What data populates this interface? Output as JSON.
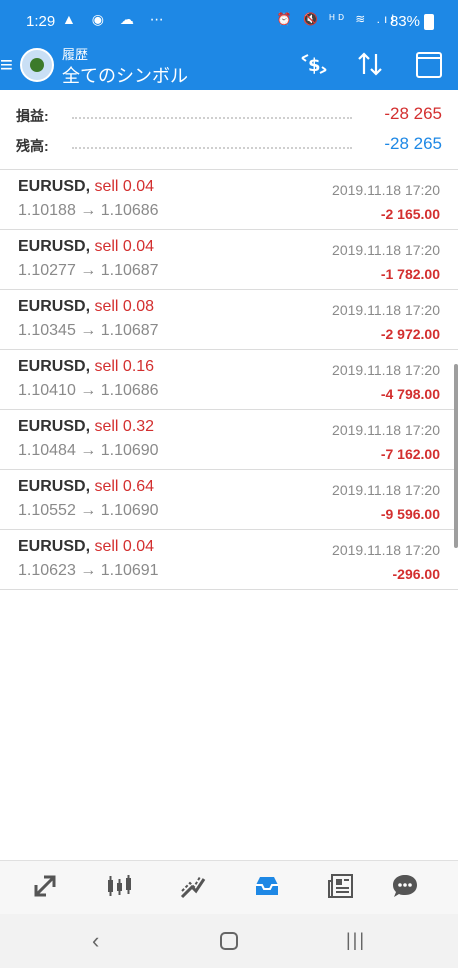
{
  "status_bar": {
    "time": "1:29",
    "left_icons": "▲ ◉ ☁ ⋯",
    "right_icons": "⏰ 🔇 ᴴᴰ ≋ .ıl",
    "battery": "83%"
  },
  "app_bar": {
    "title": "履歴",
    "subtitle": "全てのシンボル",
    "menu_icon": "hamburger-menu-icon",
    "currency_icon": "currency-exchange-icon",
    "sort_icon": "sort-icon",
    "calendar_icon": "calendar-icon"
  },
  "summary": {
    "profit_label": "損益:",
    "profit_value": "-28 265",
    "balance_label": "残高:",
    "balance_value": "-28 265"
  },
  "trades": [
    {
      "symbol": "EURUSD,",
      "side": "sell 0.04",
      "prices": "1.10188 → 1.10686",
      "date": "2019.11.18 17:20",
      "profit": "-2 165.00"
    },
    {
      "symbol": "EURUSD,",
      "side": "sell 0.04",
      "prices": "1.10277 → 1.10687",
      "date": "2019.11.18 17:20",
      "profit": "-1 782.00"
    },
    {
      "symbol": "EURUSD,",
      "side": "sell 0.08",
      "prices": "1.10345 → 1.10687",
      "date": "2019.11.18 17:20",
      "profit": "-2 972.00"
    },
    {
      "symbol": "EURUSD,",
      "side": "sell 0.16",
      "prices": "1.10410 → 1.10686",
      "date": "2019.11.18 17:20",
      "profit": "-4 798.00"
    },
    {
      "symbol": "EURUSD,",
      "side": "sell 0.32",
      "prices": "1.10484 → 1.10690",
      "date": "2019.11.18 17:20",
      "profit": "-7 162.00"
    },
    {
      "symbol": "EURUSD,",
      "side": "sell 0.64",
      "prices": "1.10552 → 1.10690",
      "date": "2019.11.18 17:20",
      "profit": "-9 596.00"
    },
    {
      "symbol": "EURUSD,",
      "side": "sell 0.04",
      "prices": "1.10623 → 1.10691",
      "date": "2019.11.18 17:20",
      "profit": "-296.00"
    }
  ],
  "tabs": [
    {
      "name": "quotes-tab",
      "glyph": "⇅"
    },
    {
      "name": "chart-tab",
      "glyph": "┃┃"
    },
    {
      "name": "trade-tab",
      "glyph": "⟋"
    },
    {
      "name": "history-tab",
      "glyph": "▣"
    },
    {
      "name": "news-tab",
      "glyph": "▤"
    },
    {
      "name": "messages-tab",
      "glyph": "💬"
    }
  ],
  "colors": {
    "primary": "#1e88e5",
    "negative": "#d32f2f",
    "muted": "#8a8a8a"
  }
}
